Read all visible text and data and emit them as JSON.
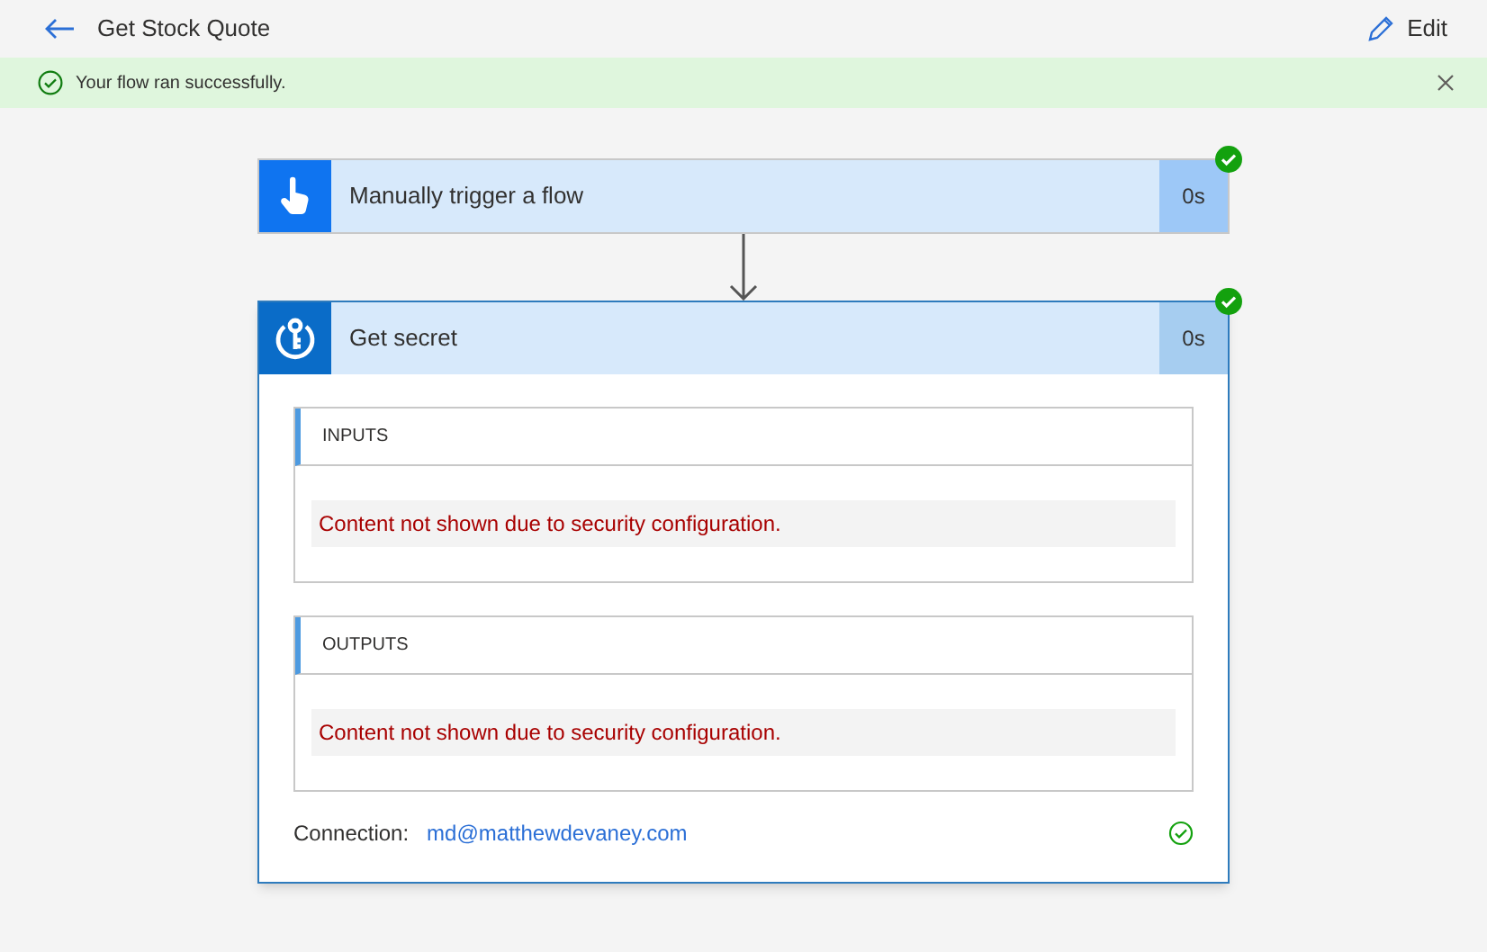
{
  "header": {
    "title": "Get Stock Quote",
    "edit_label": "Edit"
  },
  "banner": {
    "message": "Your flow ran successfully."
  },
  "steps": [
    {
      "kind": "trigger",
      "title": "Manually trigger a flow",
      "duration": "0s",
      "succeeded": true,
      "expanded": false
    },
    {
      "kind": "action",
      "title": "Get secret",
      "duration": "0s",
      "succeeded": true,
      "expanded": true,
      "sections": [
        {
          "heading": "INPUTS",
          "message": "Content not shown due to security configuration."
        },
        {
          "heading": "OUTPUTS",
          "message": "Content not shown due to security configuration."
        }
      ],
      "connection": {
        "label": "Connection:",
        "value": "md@matthewdevaney.com",
        "succeeded": true
      }
    }
  ]
}
